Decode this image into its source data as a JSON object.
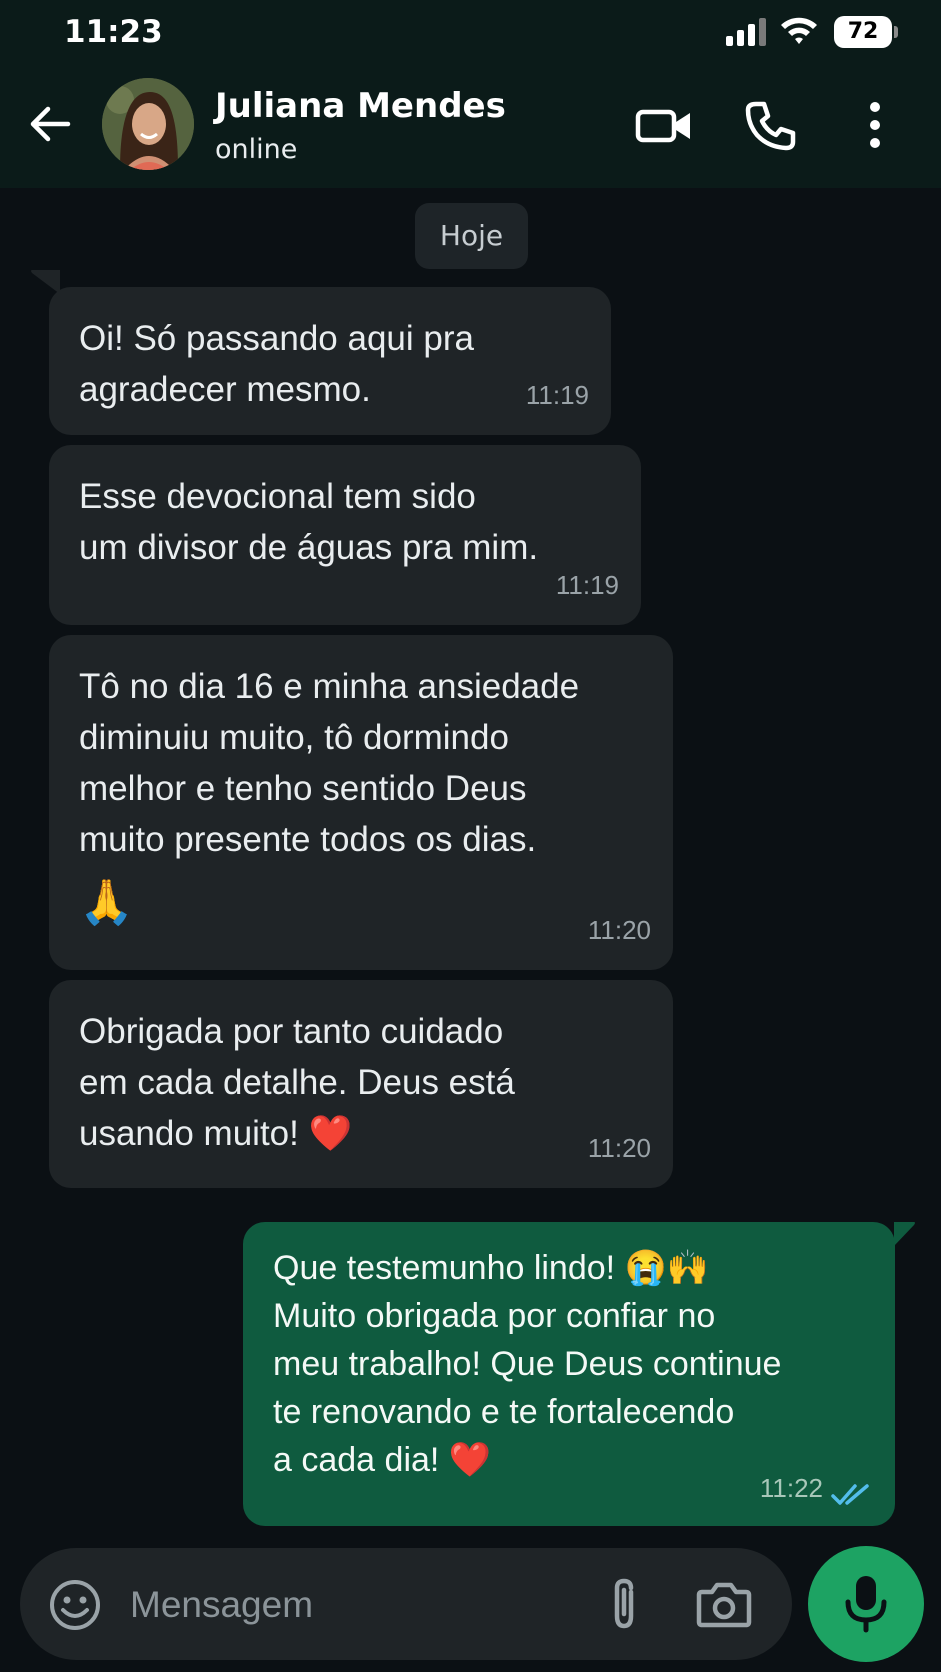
{
  "status_bar": {
    "time": "11:23",
    "battery": "72"
  },
  "header": {
    "contact_name": "Juliana Mendes",
    "contact_status": "online",
    "icons": [
      "back-arrow-icon",
      "video-call-icon",
      "voice-call-icon",
      "more-options-icon"
    ]
  },
  "chat": {
    "date_label": "Hoje",
    "messages": [
      {
        "direction": "in",
        "lines": [
          "Oi! Só passando aqui pra",
          "agradecer mesmo."
        ],
        "time": "11:19"
      },
      {
        "direction": "in",
        "lines": [
          "Esse devocional tem sido",
          "um divisor de águas pra mim."
        ],
        "time": "11:19"
      },
      {
        "direction": "in",
        "lines": [
          "Tô no dia 16 e minha ansiedade",
          "diminuiu muito, tô dormindo",
          "melhor e tenho sentido Deus",
          "muito presente todos os dias.",
          "🙏"
        ],
        "time": "11:20"
      },
      {
        "direction": "in",
        "lines": [
          "Obrigada por tanto cuidado",
          "em cada detalhe. Deus está",
          "usando muito! ❤️"
        ],
        "time": "11:20"
      },
      {
        "direction": "out",
        "lines": [
          "Que testemunho lindo! 😭🙌",
          "Muito obrigada por confiar no",
          "meu trabalho! Que Deus continue",
          "te renovando e te fortalecendo",
          "a cada dia! ❤️"
        ],
        "time": "11:22",
        "read_status": "read"
      }
    ]
  },
  "composer": {
    "placeholder": "Mensagem"
  },
  "colors": {
    "header_bg": "#0b1b19",
    "chat_bg": "#0b1014",
    "incoming_bubble": "#1f2427",
    "outgoing_bubble": "#0f5b3f",
    "mic_button": "#1da363",
    "read_ticks": "#53bdeb"
  }
}
